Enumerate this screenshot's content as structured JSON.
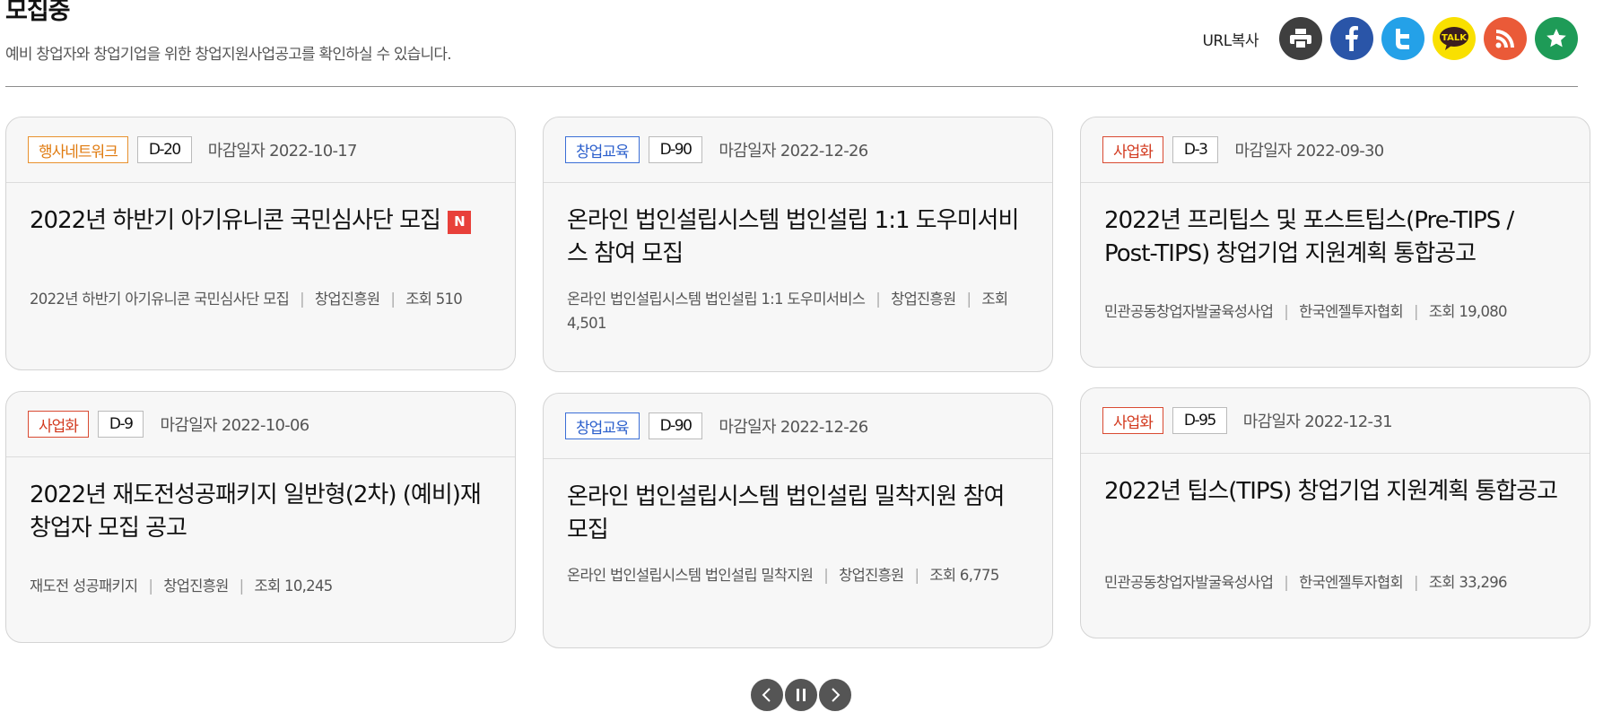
{
  "header": {
    "title": "모집중",
    "description": "예비 창업자와 창업기업을 위한 창업지원사업공고를 확인하실 수 있습니다.",
    "url_copy_label": "URL복사",
    "share_colors": {
      "print": "#3f3f3f",
      "facebook": "#2a55a8",
      "twitter": "#24a1e8",
      "kakao": "#f9e000",
      "rss": "#ea5a38",
      "bookmark": "#1e9b57"
    },
    "kakao_label": "TALK"
  },
  "cards": [
    {
      "tag": "행사네트워크",
      "tag_color": "orange",
      "dday": "D-20",
      "deadline": "마감일자 2022-10-17",
      "title": "2022년 하반기 아기유니콘 국민심사단 모집",
      "new": "N",
      "meta_program": "2022년 하반기 아기유니콘 국민심사단 모집",
      "meta_org": "창업진흥원",
      "meta_views": "조회 510"
    },
    {
      "tag": "창업교육",
      "tag_color": "blue",
      "dday": "D-90",
      "deadline": "마감일자 2022-12-26",
      "title": "온라인 법인설립시스템 법인설립 1:1 도우미서비스 참여 모집",
      "meta_program": "온라인 법인설립시스템 법인설립 1:1 도우미서비스",
      "meta_org": "창업진흥원",
      "meta_views": "조회 4,501"
    },
    {
      "tag": "사업화",
      "tag_color": "red",
      "dday": "D-3",
      "deadline": "마감일자 2022-09-30",
      "title": "2022년 프리팁스 및 포스트팁스(Pre-TIPS / Post-TIPS) 창업기업 지원계획 통합공고",
      "meta_program": "민관공동창업자발굴육성사업",
      "meta_org": "한국엔젤투자협회",
      "meta_views": "조회 19,080"
    },
    {
      "tag": "사업화",
      "tag_color": "red",
      "dday": "D-9",
      "deadline": "마감일자 2022-10-06",
      "title": "2022년 재도전성공패키지 일반형(2차) (예비)재창업자 모집 공고",
      "meta_program": "재도전 성공패키지",
      "meta_org": "창업진흥원",
      "meta_views": "조회 10,245"
    },
    {
      "tag": "창업교육",
      "tag_color": "blue",
      "dday": "D-90",
      "deadline": "마감일자 2022-12-26",
      "title": "온라인 법인설립시스템 법인설립 밀착지원 참여 모집",
      "meta_program": "온라인 법인설립시스템 법인설립 밀착지원",
      "meta_org": "창업진흥원",
      "meta_views": "조회 6,775"
    },
    {
      "tag": "사업화",
      "tag_color": "red",
      "dday": "D-95",
      "deadline": "마감일자 2022-12-31",
      "title": "2022년 팁스(TIPS) 창업기업 지원계획 통합공고",
      "meta_program": "민관공동창업자발굴육성사업",
      "meta_org": "한국엔젤투자협회",
      "meta_views": "조회 33,296"
    }
  ],
  "pager": {
    "prev_icon": "chevron-left-icon",
    "pause_icon": "pause-icon",
    "next_icon": "chevron-right-icon"
  }
}
